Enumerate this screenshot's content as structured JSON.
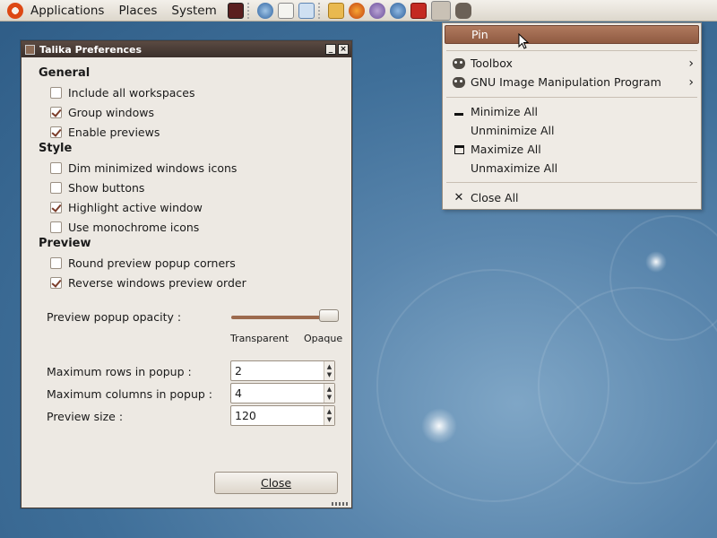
{
  "panel": {
    "menus": [
      "Applications",
      "Places",
      "System"
    ],
    "launchers": [
      "terminal-icon",
      "firefox-like-icon",
      "editor-icon",
      "screenshot-icon",
      "files-icon",
      "firefox-icon",
      "pidgin-icon",
      "network-icon",
      "app-icon",
      "talika-icon",
      "gimp-icon"
    ]
  },
  "prefs_window": {
    "title": "Talika Preferences",
    "sections": [
      {
        "title": "General",
        "options": [
          {
            "label": "Include all workspaces",
            "checked": false
          },
          {
            "label": "Group windows",
            "checked": true
          },
          {
            "label": "Enable previews",
            "checked": true
          }
        ]
      },
      {
        "title": "Style",
        "options": [
          {
            "label": "Dim minimized windows icons",
            "checked": false
          },
          {
            "label": "Show buttons",
            "checked": false
          },
          {
            "label": "Highlight active window",
            "checked": true
          },
          {
            "label": "Use monochrome icons",
            "checked": false
          }
        ]
      },
      {
        "title": "Preview",
        "options": [
          {
            "label": "Round preview popup corners",
            "checked": false
          },
          {
            "label": "Reverse windows preview order",
            "checked": true
          }
        ]
      }
    ],
    "opacity": {
      "label": "Preview popup opacity :",
      "min_label": "Transparent",
      "max_label": "Opaque",
      "value_fraction": 0.95
    },
    "spinners": [
      {
        "label": "Maximum rows in popup :",
        "value": "2"
      },
      {
        "label": "Maximum columns in popup :",
        "value": "4"
      },
      {
        "label": "Preview size :",
        "value": "120"
      }
    ],
    "close_label": "Close"
  },
  "context_menu": {
    "items": [
      {
        "label": "Pin",
        "icon": "",
        "submenu": false,
        "active": true
      },
      {
        "label": "Toolbox",
        "icon": "gimp-icon",
        "submenu": true,
        "active": false
      },
      {
        "label": "GNU Image Manipulation Program",
        "icon": "gimp-icon",
        "submenu": true,
        "active": false
      },
      {
        "label": "Minimize All",
        "icon": "minimize-icon",
        "submenu": false,
        "active": false
      },
      {
        "label": "Unminimize All",
        "icon": "",
        "submenu": false,
        "active": false
      },
      {
        "label": "Maximize All",
        "icon": "maximize-icon",
        "submenu": false,
        "active": false
      },
      {
        "label": "Unmaximize All",
        "icon": "",
        "submenu": false,
        "active": false
      },
      {
        "label": "Close All",
        "icon": "close-icon",
        "submenu": false,
        "active": false
      }
    ]
  },
  "colors": {
    "accent": "#9c6a4e",
    "titlebar": "#3b302b",
    "menu_highlight": "#a06d52",
    "desktop": "#3f6f99"
  }
}
